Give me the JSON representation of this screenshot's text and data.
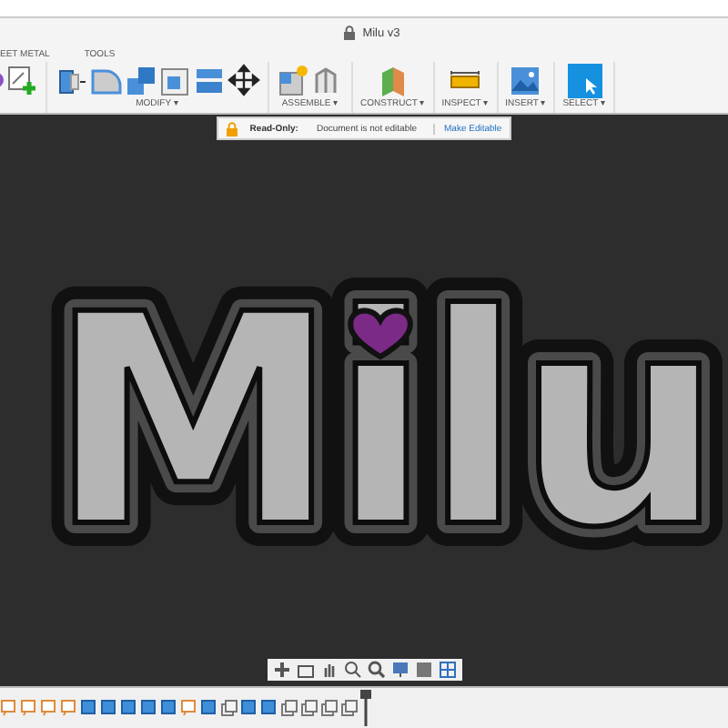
{
  "window": {
    "title": "Milu v3",
    "locked": true
  },
  "toolbar": {
    "top_labels": [
      "EET METAL",
      "TOOLS"
    ],
    "groups": [
      {
        "label": "MODIFY ▾"
      },
      {
        "label": "ASSEMBLE ▾"
      },
      {
        "label": "CONSTRUCT ▾"
      },
      {
        "label": "INSPECT ▾"
      },
      {
        "label": "INSERT ▾"
      },
      {
        "label": "SELECT ▾"
      }
    ]
  },
  "banner": {
    "label": "Read-Only:",
    "message": "Document is not editable",
    "action": "Make Editable"
  },
  "model_text": "Milu",
  "timeline": [
    {
      "kind": "sketch"
    },
    {
      "kind": "sketch"
    },
    {
      "kind": "sketch"
    },
    {
      "kind": "sketch"
    },
    {
      "kind": "body"
    },
    {
      "kind": "body"
    },
    {
      "kind": "body"
    },
    {
      "kind": "body"
    },
    {
      "kind": "body"
    },
    {
      "kind": "sketch"
    },
    {
      "kind": "body"
    },
    {
      "kind": "component"
    },
    {
      "kind": "body"
    },
    {
      "kind": "body"
    },
    {
      "kind": "component"
    },
    {
      "kind": "component"
    },
    {
      "kind": "component"
    },
    {
      "kind": "component"
    }
  ]
}
